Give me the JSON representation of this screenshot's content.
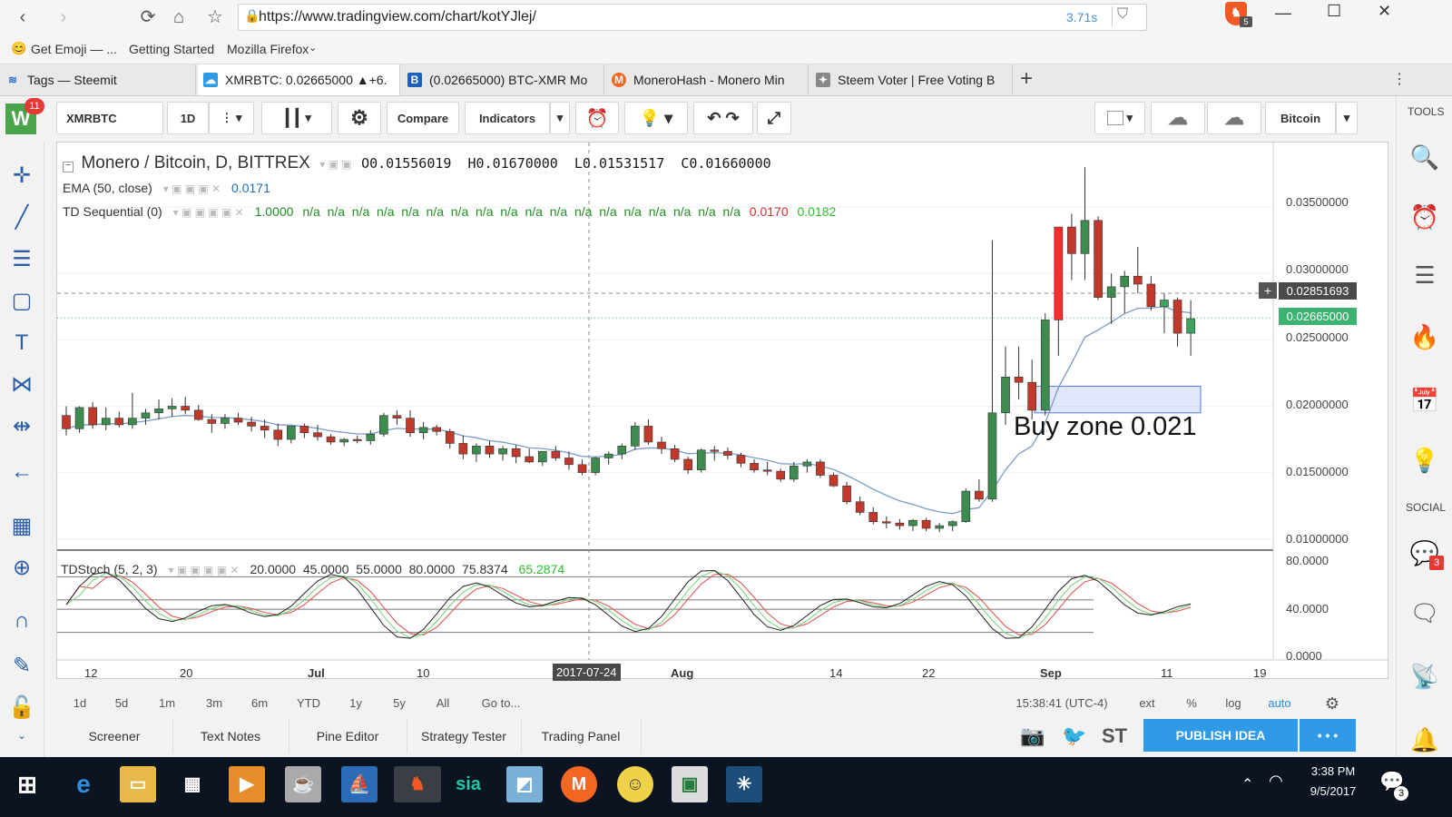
{
  "browser": {
    "url": "https://www.tradingview.com/chart/kotYJlej/",
    "load_time": "3.71s",
    "brave_badge": "5",
    "bookmarks": [
      "Get Emoji — ...",
      "Getting Started",
      "Mozilla Firefox"
    ],
    "tabs": [
      {
        "label": "Tags — Steemit",
        "icon": "steemit-icon"
      },
      {
        "label": "XMRBTC: 0.02665000 ▲+6.",
        "icon": "tradingview-icon"
      },
      {
        "label": "(0.02665000) BTC-XMR Mo",
        "icon": "bittrex-icon"
      },
      {
        "label": "MoneroHash - Monero Min",
        "icon": "monero-icon"
      },
      {
        "label": "Steem Voter | Free Voting B",
        "icon": "steem-voter-icon"
      }
    ]
  },
  "toolbar": {
    "symbol": "XMRBTC",
    "interval": "1D",
    "compare": "Compare",
    "indicators": "Indicators",
    "profile": "Bitcoin",
    "avatar_letter": "W",
    "avatar_badge": "11"
  },
  "right_sidebar": {
    "tools": "TOOLS",
    "social": "SOCIAL",
    "chat_badge": "3"
  },
  "legend": {
    "title": "Monero / Bitcoin, D, BITTREX",
    "ohlc": "O0.01556019  H0.01670000  L0.01531517  C0.01660000",
    "ema_label": "EMA (50, close)",
    "ema_value": "0.0171",
    "tds_label": "TD Sequential (0)",
    "tds_first": "1.0000",
    "tds_na": "n/a  n/a  n/a  n/a  n/a  n/a  n/a  n/a  n/a  n/a  n/a  n/a  n/a  n/a  n/a  n/a  n/a  n/a",
    "tds_red": "0.0170",
    "tds_green": "0.0182",
    "stoch_label": "TDStoch (5, 2, 3)",
    "stoch_values": "20.0000  45.0000  55.0000  80.0000  75.8374",
    "stoch_green": "65.2874"
  },
  "annotation": "Buy zone 0.021",
  "price_scale": [
    "0.03500000",
    "0.03000000",
    "0.02500000",
    "0.02000000",
    "0.01500000",
    "0.01000000"
  ],
  "price_markers": {
    "crosshair": "0.02851693",
    "last": "0.02665000"
  },
  "stoch_scale": [
    "80.0000",
    "40.0000",
    "0.0000"
  ],
  "time_axis": [
    "12",
    "20",
    "Jul",
    "10",
    "2017-07-24",
    "Aug",
    "14",
    "22",
    "Sep",
    "11",
    "19"
  ],
  "bottom_bar": {
    "ranges": [
      "1d",
      "5d",
      "1m",
      "3m",
      "6m",
      "YTD",
      "1y",
      "5y",
      "All"
    ],
    "goto": "Go to...",
    "clock": "15:38:41 (UTC-4)",
    "opts": [
      "ext",
      "%",
      "log",
      "auto"
    ]
  },
  "panels": [
    "Screener",
    "Text Notes",
    "Pine Editor",
    "Strategy Tester",
    "Trading Panel"
  ],
  "publish": "PUBLISH IDEA",
  "publish_more": "• • •",
  "st": "ST",
  "taskbar": {
    "time": "3:38 PM",
    "date": "9/5/2017",
    "notif": "3",
    "sia": "sia"
  },
  "chart_data": {
    "type": "candlestick",
    "title": "Monero / Bitcoin, D, BITTREX",
    "ylim": [
      0.0095,
      0.0385
    ],
    "y_ticks": [
      0.035,
      0.03,
      0.025,
      0.02,
      0.015,
      0.01
    ],
    "last_price": 0.02665,
    "crosshair_price": 0.02851693,
    "buy_zone": 0.021,
    "candles": [
      [
        0.0193,
        0.02,
        0.0178,
        0.0183
      ],
      [
        0.0183,
        0.02,
        0.018,
        0.0199
      ],
      [
        0.0199,
        0.0203,
        0.0183,
        0.0186
      ],
      [
        0.0186,
        0.0199,
        0.0182,
        0.0191
      ],
      [
        0.0191,
        0.0196,
        0.0184,
        0.0186
      ],
      [
        0.0186,
        0.021,
        0.0183,
        0.0191
      ],
      [
        0.0191,
        0.0198,
        0.0186,
        0.0195
      ],
      [
        0.0195,
        0.0205,
        0.019,
        0.0198
      ],
      [
        0.0198,
        0.0206,
        0.0192,
        0.02
      ],
      [
        0.02,
        0.0207,
        0.0194,
        0.0197
      ],
      [
        0.0197,
        0.0201,
        0.0189,
        0.019
      ],
      [
        0.019,
        0.0194,
        0.018,
        0.0187
      ],
      [
        0.0187,
        0.0194,
        0.0183,
        0.0191
      ],
      [
        0.0191,
        0.0195,
        0.0186,
        0.0188
      ],
      [
        0.0188,
        0.0192,
        0.0181,
        0.0185
      ],
      [
        0.0185,
        0.019,
        0.0176,
        0.0182
      ],
      [
        0.0182,
        0.0187,
        0.017,
        0.0175
      ],
      [
        0.0175,
        0.0185,
        0.0172,
        0.0185
      ],
      [
        0.0185,
        0.0187,
        0.0176,
        0.018
      ],
      [
        0.018,
        0.0186,
        0.0174,
        0.0177
      ],
      [
        0.0177,
        0.0179,
        0.0171,
        0.0173
      ],
      [
        0.0173,
        0.0176,
        0.017,
        0.0175
      ],
      [
        0.0175,
        0.0178,
        0.0172,
        0.0174
      ],
      [
        0.0174,
        0.0182,
        0.0171,
        0.0179
      ],
      [
        0.0179,
        0.0195,
        0.0177,
        0.0193
      ],
      [
        0.0193,
        0.0197,
        0.0186,
        0.0191
      ],
      [
        0.0191,
        0.0197,
        0.0177,
        0.018
      ],
      [
        0.018,
        0.0188,
        0.0175,
        0.0184
      ],
      [
        0.0184,
        0.0186,
        0.0178,
        0.0181
      ],
      [
        0.0181,
        0.0183,
        0.0168,
        0.0172
      ],
      [
        0.0172,
        0.0178,
        0.016,
        0.0164
      ],
      [
        0.0164,
        0.0172,
        0.0158,
        0.017
      ],
      [
        0.017,
        0.0174,
        0.0161,
        0.0164
      ],
      [
        0.0164,
        0.017,
        0.0159,
        0.0168
      ],
      [
        0.0168,
        0.0171,
        0.0157,
        0.0162
      ],
      [
        0.0162,
        0.0168,
        0.0157,
        0.0158
      ],
      [
        0.0158,
        0.0166,
        0.0155,
        0.0166
      ],
      [
        0.0166,
        0.017,
        0.0159,
        0.0161
      ],
      [
        0.0161,
        0.0166,
        0.0152,
        0.0156
      ],
      [
        0.0156,
        0.016,
        0.0148,
        0.015
      ],
      [
        0.015,
        0.0162,
        0.0148,
        0.0161
      ],
      [
        0.0161,
        0.0166,
        0.0156,
        0.0164
      ],
      [
        0.0164,
        0.0172,
        0.016,
        0.017
      ],
      [
        0.017,
        0.0188,
        0.0167,
        0.0185
      ],
      [
        0.0185,
        0.019,
        0.0171,
        0.0173
      ],
      [
        0.0173,
        0.0177,
        0.0164,
        0.0168
      ],
      [
        0.0168,
        0.0171,
        0.0158,
        0.016
      ],
      [
        0.016,
        0.0162,
        0.0149,
        0.0152
      ],
      [
        0.0152,
        0.0168,
        0.015,
        0.0167
      ],
      [
        0.0167,
        0.017,
        0.0159,
        0.0166
      ],
      [
        0.0166,
        0.0169,
        0.016,
        0.0163
      ],
      [
        0.0163,
        0.0165,
        0.0154,
        0.0157
      ],
      [
        0.0157,
        0.016,
        0.015,
        0.0152
      ],
      [
        0.0152,
        0.0158,
        0.0148,
        0.0151
      ],
      [
        0.0151,
        0.0153,
        0.0143,
        0.0145
      ],
      [
        0.0145,
        0.0158,
        0.0143,
        0.0155
      ],
      [
        0.0155,
        0.016,
        0.015,
        0.0158
      ],
      [
        0.0158,
        0.016,
        0.0146,
        0.0148
      ],
      [
        0.0148,
        0.015,
        0.0139,
        0.014
      ],
      [
        0.014,
        0.0143,
        0.0126,
        0.0128
      ],
      [
        0.0128,
        0.0132,
        0.0118,
        0.012
      ],
      [
        0.012,
        0.0124,
        0.0111,
        0.0113
      ],
      [
        0.0113,
        0.0117,
        0.0108,
        0.0112
      ],
      [
        0.0112,
        0.0115,
        0.0107,
        0.011
      ],
      [
        0.011,
        0.0115,
        0.0106,
        0.0114
      ],
      [
        0.0114,
        0.0116,
        0.0106,
        0.0108
      ],
      [
        0.0108,
        0.0112,
        0.0105,
        0.011
      ],
      [
        0.011,
        0.0114,
        0.0106,
        0.0113
      ],
      [
        0.0113,
        0.0138,
        0.0112,
        0.0136
      ],
      [
        0.0136,
        0.0145,
        0.0128,
        0.013
      ],
      [
        0.013,
        0.0325,
        0.0128,
        0.0195
      ],
      [
        0.0195,
        0.0245,
        0.0186,
        0.0222
      ],
      [
        0.0222,
        0.0245,
        0.0205,
        0.0218
      ],
      [
        0.0218,
        0.0235,
        0.019,
        0.0197
      ],
      [
        0.0197,
        0.027,
        0.0193,
        0.0265
      ],
      [
        0.0265,
        0.0325,
        0.0238,
        0.0335
      ],
      [
        0.0335,
        0.0345,
        0.0295,
        0.0315
      ],
      [
        0.0315,
        0.038,
        0.0295,
        0.034
      ],
      [
        0.034,
        0.0343,
        0.028,
        0.0282
      ],
      [
        0.0282,
        0.03,
        0.0262,
        0.029
      ],
      [
        0.029,
        0.0302,
        0.027,
        0.0298
      ],
      [
        0.0298,
        0.032,
        0.0285,
        0.0292
      ],
      [
        0.0292,
        0.0298,
        0.0272,
        0.0275
      ],
      [
        0.0275,
        0.0285,
        0.0255,
        0.028
      ],
      [
        0.028,
        0.0282,
        0.0245,
        0.0255
      ],
      [
        0.0255,
        0.028,
        0.0238,
        0.0266
      ]
    ]
  }
}
